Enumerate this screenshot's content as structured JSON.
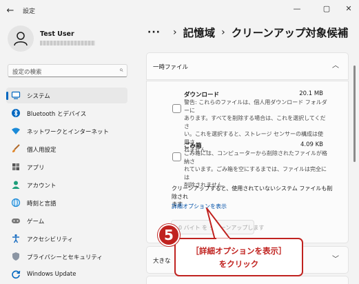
{
  "window": {
    "title": "設定",
    "back_glyph": "←",
    "minimize_glyph": "—",
    "maximize_glyph": "▢",
    "close_glyph": "✕"
  },
  "user": {
    "name": "Test User"
  },
  "search": {
    "placeholder": "設定の検索",
    "icon": "search-icon"
  },
  "sidebar": {
    "items": [
      {
        "label": "システム",
        "icon": "system-icon",
        "selected": true
      },
      {
        "label": "Bluetooth とデバイス",
        "icon": "bluetooth-icon"
      },
      {
        "label": "ネットワークとインターネット",
        "icon": "wifi-icon"
      },
      {
        "label": "個人用設定",
        "icon": "brush-icon"
      },
      {
        "label": "アプリ",
        "icon": "apps-icon"
      },
      {
        "label": "アカウント",
        "icon": "account-icon"
      },
      {
        "label": "時刻と言語",
        "icon": "globe-icon"
      },
      {
        "label": "ゲーム",
        "icon": "game-icon"
      },
      {
        "label": "アクセシビリティ",
        "icon": "accessibility-icon"
      },
      {
        "label": "プライバシーとセキュリティ",
        "icon": "shield-icon"
      },
      {
        "label": "Windows Update",
        "icon": "windows-update-icon"
      }
    ]
  },
  "breadcrumb": {
    "dots": "···",
    "sep1": "›",
    "parent": "記憶域",
    "sep2": "›",
    "current": "クリーンアップ対象候補"
  },
  "temp_files": {
    "title": "一時ファイル",
    "items": [
      {
        "name": "ダウンロード",
        "size": "20.1 MB",
        "checked": false,
        "description": [
          "警告: これらのファイルは、個人用ダウンロード フォルダーに",
          "あります。すべてを削除する場合は、これを選択してくださ",
          "い。これを選択すると、ストレージ センサーの構成は使用さ",
          "れません。"
        ]
      },
      {
        "name": "ごみ箱",
        "size": "4.09 KB",
        "checked": false,
        "description": [
          "ごみ箱には、コンピューターから削除されたファイルが格納さ",
          "れています。ごみ箱を空にするまでは、ファイルは完全には",
          "削除されません。"
        ]
      }
    ],
    "info": [
      "クリーンアップすると、使用されていないシステム ファイルも削除され",
      "ます"
    ],
    "advanced_link": "詳細オプションを表示",
    "cleanup_button": "0 バイト を クリーンアップします"
  },
  "large_files": {
    "title": "大きな"
  },
  "annotation": {
    "step": "5",
    "line1": "［詳細オプションを表示］",
    "line2": "をクリック",
    "color": "#c0221f"
  }
}
